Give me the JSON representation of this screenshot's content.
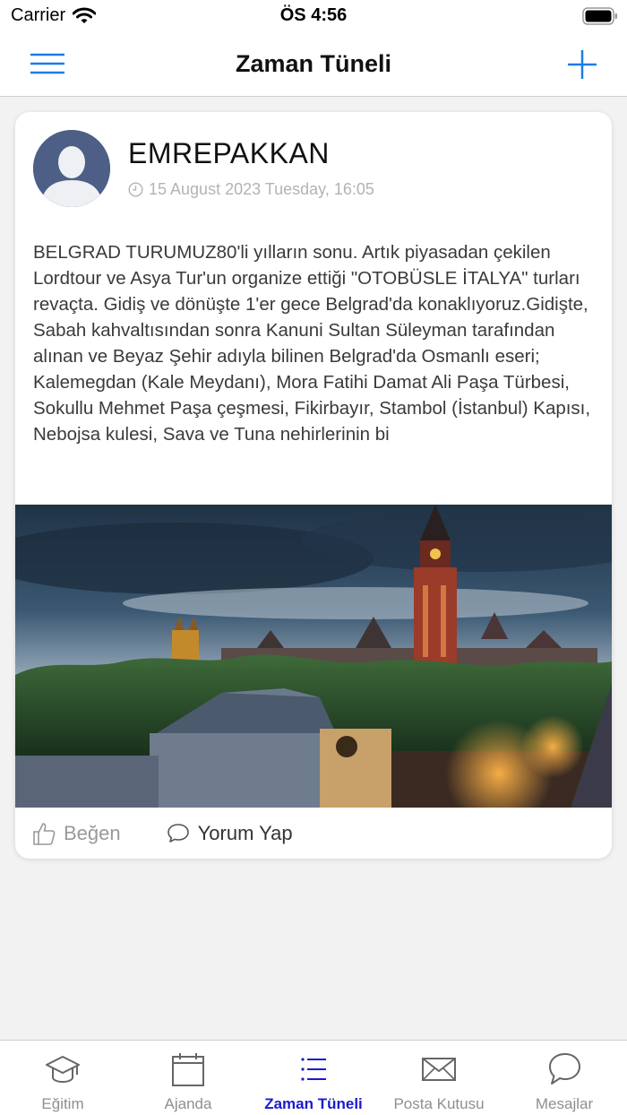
{
  "status_bar": {
    "carrier": "Carrier",
    "time": "ÖS 4:56"
  },
  "header": {
    "title": "Zaman Tüneli",
    "menu_icon": "hamburger-icon",
    "add_icon": "plus-icon",
    "accent_color": "#1e7be6"
  },
  "post": {
    "author": "EMREPAKKAN",
    "date": "15 August 2023 Tuesday, 16:05",
    "text": "BELGRAD TURUMUZ80'li yılların sonu. Artık piyasadan çekilen Lordtour ve Asya Tur'un organize ettiği \"OTOBÜSLE İTALYA\" turları revaçta. Gidiş ve dönüşte 1'er gece Belgrad'da konaklıyoruz.Gidişte, Sabah kahvaltısından sonra Kanuni Sultan Süleyman tarafından alınan ve Beyaz Şehir adıyla bilinen Belgrad'da Osmanlı eseri; Kalemegdan (Kale Meydanı), Mora Fatihi Damat Ali Paşa Türbesi, Sokullu Mehmet Paşa çeşmesi, Fikirbayır, Stambol (İstanbul) Kapısı, Nebojsa kulesi, Sava ve Tuna nehirlerinin bi",
    "like_label": "Beğen",
    "comment_label": "Yorum Yap"
  },
  "tabs": [
    {
      "label": "Eğitim",
      "icon": "graduation-cap-icon",
      "active": false
    },
    {
      "label": "Ajanda",
      "icon": "calendar-icon",
      "active": false
    },
    {
      "label": "Zaman Tüneli",
      "icon": "list-icon",
      "active": true
    },
    {
      "label": "Posta Kutusu",
      "icon": "envelope-icon",
      "active": false
    },
    {
      "label": "Mesajlar",
      "icon": "chat-bubble-icon",
      "active": false
    }
  ],
  "colors": {
    "active_tab": "#1a1ad0",
    "inactive_tab": "#8f8f8f",
    "avatar_bg": "#4d5f86"
  }
}
